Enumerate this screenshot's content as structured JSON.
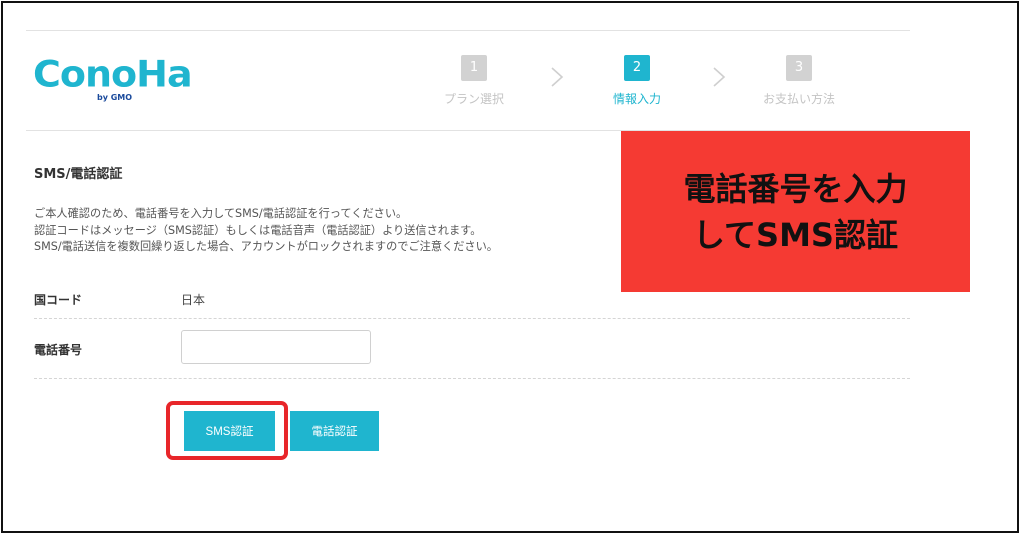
{
  "logo": {
    "main": "ConoHa",
    "sub": "by GMO"
  },
  "steps": [
    {
      "num": "1",
      "label": "プラン選択"
    },
    {
      "num": "2",
      "label": "情報入力"
    },
    {
      "num": "3",
      "label": "お支払い方法"
    }
  ],
  "section_title": "SMS/電話認証",
  "description": [
    "ご本人確認のため、電話番号を入力してSMS/電話認証を行ってください。",
    "認証コードはメッセージ（SMS認証）もしくは電話音声（電話認証）より送信されます。",
    "SMS/電話送信を複数回繰り返した場合、アカウントがロックされますのでご注意ください。"
  ],
  "country": {
    "label": "国コード",
    "value": "日本"
  },
  "phone": {
    "label": "電話番号",
    "value": "",
    "placeholder": ""
  },
  "buttons": {
    "sms": "SMS認証",
    "voice": "電話認証"
  },
  "callout": {
    "line1": "電話番号を入力",
    "line2": "してSMS認証"
  },
  "colors": {
    "brand": "#1fb5cf",
    "step_inactive": "#d2d2d2",
    "callout_bg": "#f53a33",
    "highlight": "#e8262a"
  }
}
